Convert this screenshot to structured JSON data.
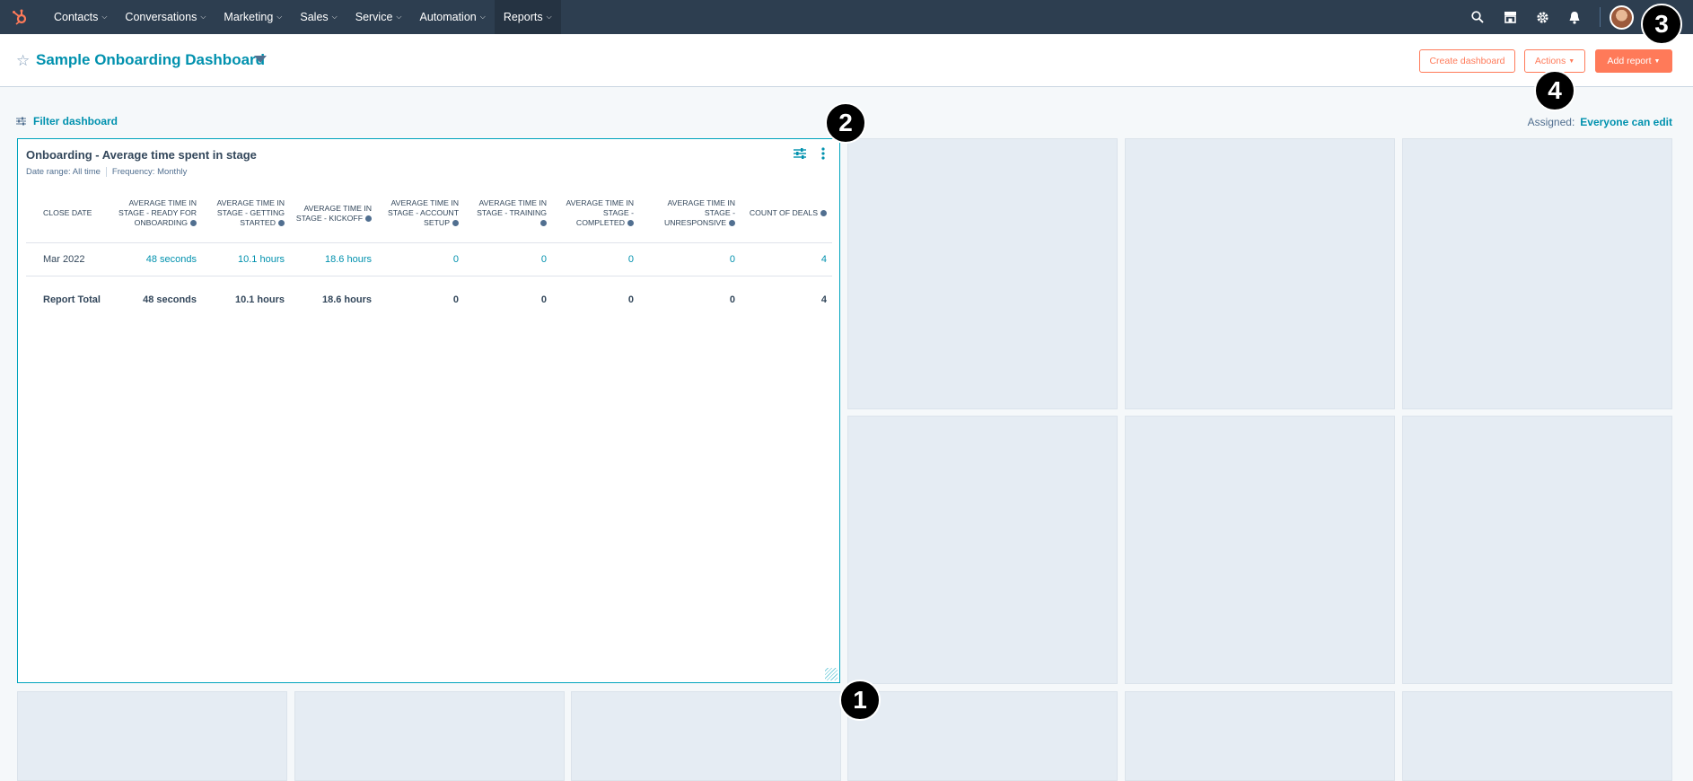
{
  "topnav": {
    "items": [
      {
        "label": "Contacts"
      },
      {
        "label": "Conversations"
      },
      {
        "label": "Marketing"
      },
      {
        "label": "Sales"
      },
      {
        "label": "Service"
      },
      {
        "label": "Automation"
      },
      {
        "label": "Reports"
      }
    ],
    "active": "Reports",
    "icons": [
      "search-icon",
      "marketplace-icon",
      "gear-icon",
      "bell-icon"
    ],
    "brand_color": "#2d3e50"
  },
  "header": {
    "title": "Sample Onboarding Dashboard",
    "create_dashboard": "Create dashboard",
    "actions": "Actions",
    "add_report": "Add report"
  },
  "filter": {
    "label": "Filter dashboard",
    "assigned_label": "Assigned:",
    "assigned_value": "Everyone can edit"
  },
  "report": {
    "title": "Onboarding - Average time spent in stage",
    "date_range": "Date range: All time",
    "frequency": "Frequency: Monthly",
    "columns": [
      "CLOSE DATE",
      "AVERAGE TIME IN STAGE - READY FOR ONBOARDING",
      "AVERAGE TIME IN STAGE - GETTING STARTED",
      "AVERAGE TIME IN STAGE - KICKOFF",
      "AVERAGE TIME IN STAGE - ACCOUNT SETUP",
      "AVERAGE TIME IN STAGE - TRAINING",
      "AVERAGE TIME IN STAGE - COMPLETED",
      "AVERAGE TIME IN STAGE - UNRESPONSIVE",
      "COUNT OF DEALS"
    ],
    "rows": [
      [
        "Mar 2022",
        "48 seconds",
        "10.1 hours",
        "18.6 hours",
        "0",
        "0",
        "0",
        "0",
        "4"
      ]
    ],
    "total": [
      "Report Total",
      "48 seconds",
      "10.1 hours",
      "18.6 hours",
      "0",
      "0",
      "0",
      "0",
      "4"
    ]
  },
  "markers": [
    "1",
    "2",
    "3",
    "4"
  ],
  "accent": "#ff7a59",
  "link_color": "#0091ae"
}
